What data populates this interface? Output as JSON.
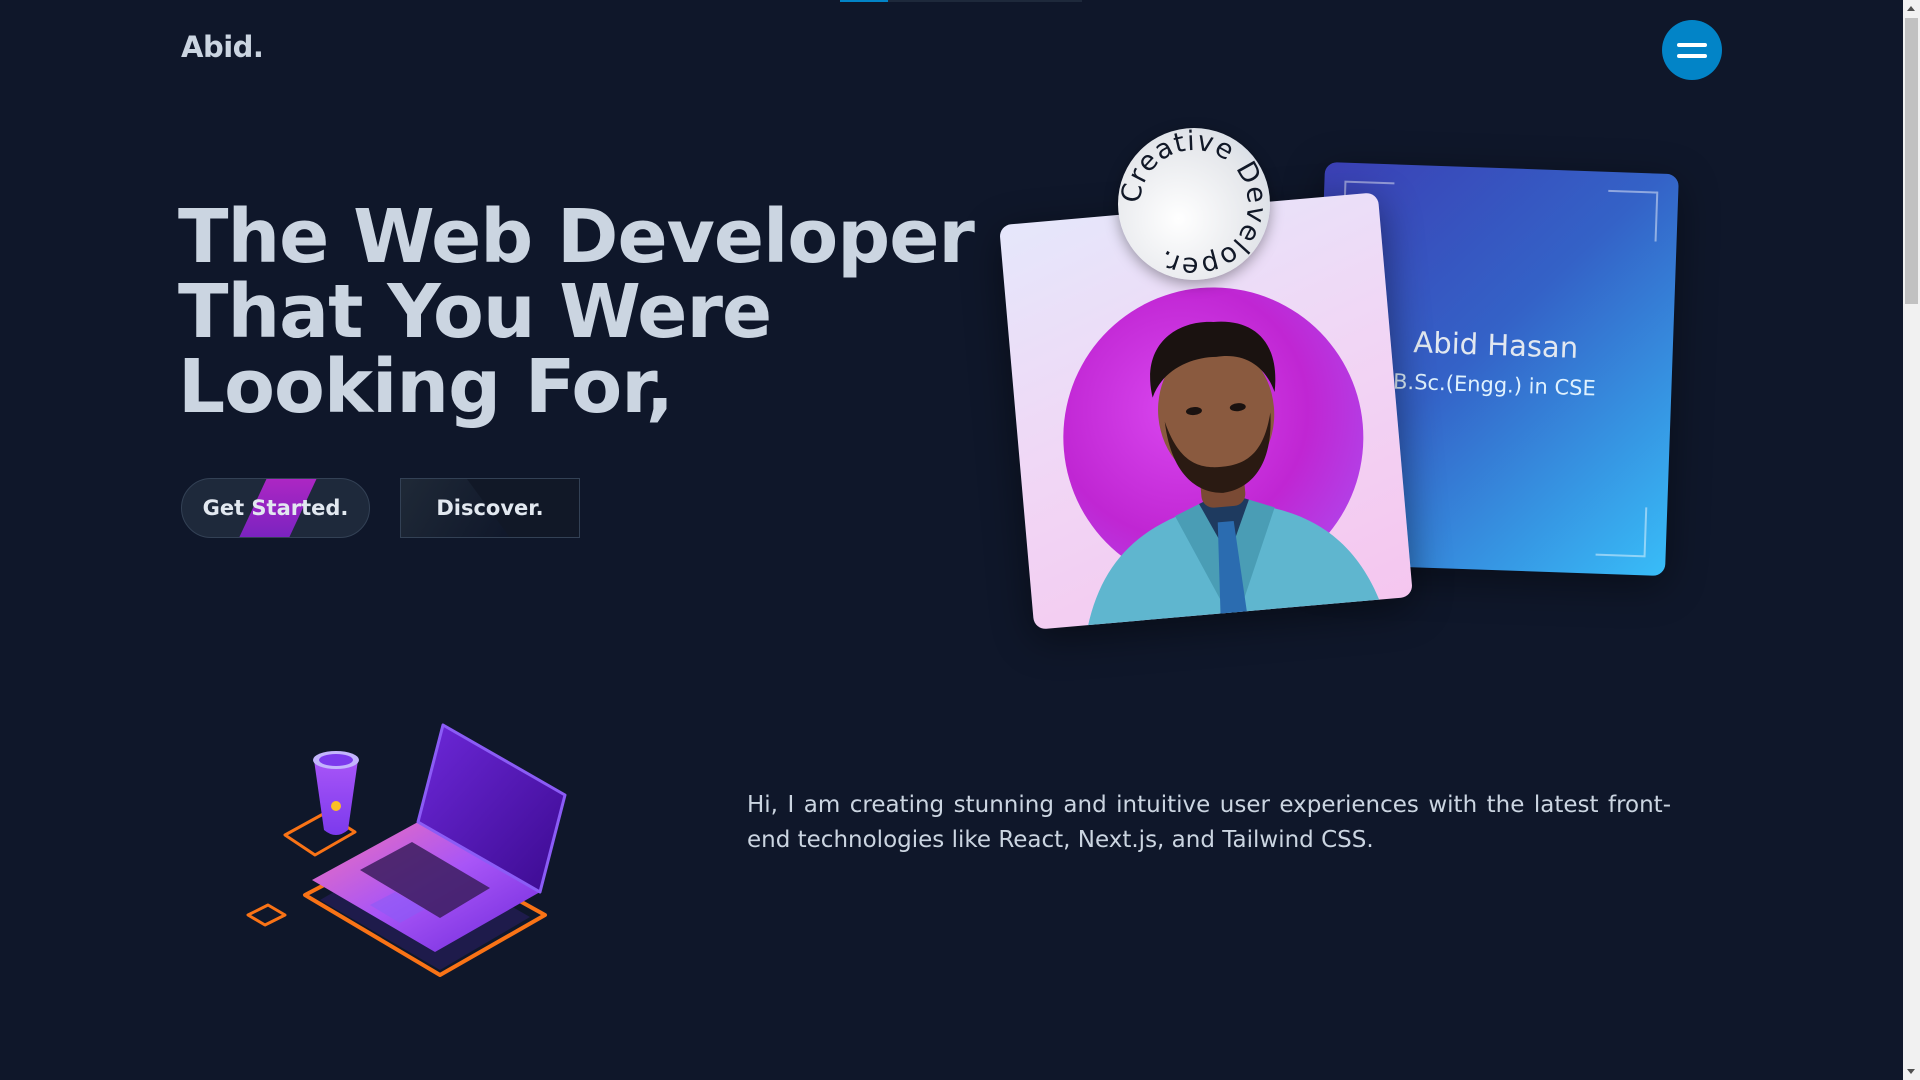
{
  "header": {
    "logo": "Abid.",
    "menu_icon": "hamburger-icon",
    "menu_color": "#0284c7"
  },
  "hero": {
    "headline_lines": [
      "The Web Developer",
      "That You Were",
      "Looking For,"
    ],
    "get_started_label": "Get Started.",
    "discover_label": "Discover."
  },
  "profile_card": {
    "badge_text": "Creative Developer.",
    "name": "Abid Hasan",
    "degree": "B.Sc.(Engg.) in CSE"
  },
  "about": {
    "intro": "Hi, I am creating stunning and intuitive user experiences with the latest front-end technologies like React, Next.js, and Tailwind CSS."
  },
  "colors": {
    "background": "#0f172a",
    "text": "#cbd5e1",
    "accent_purple": "#c026d3",
    "accent_blue": "#38bdf8"
  }
}
